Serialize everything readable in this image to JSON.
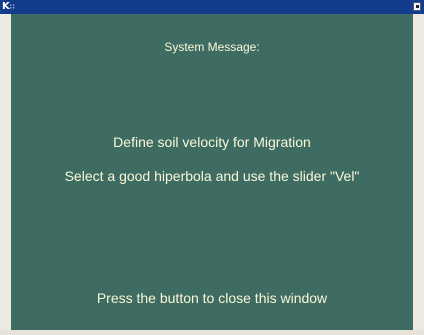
{
  "window": {
    "app_icon_letter": "K",
    "app_icon_suffix": "∷",
    "title": ""
  },
  "message": {
    "heading": "System Message:",
    "line1": "Define soil velocity for Migration",
    "line2": "Select a good hiperbola and use the slider \"Vel\"",
    "line3": "Press the button to close this window"
  },
  "colors": {
    "titlebar": "#143c8c",
    "background": "#3e6b62",
    "text": "#f8f8d8"
  },
  "icons": {
    "app": "kde-k-icon",
    "close": "close-icon"
  }
}
